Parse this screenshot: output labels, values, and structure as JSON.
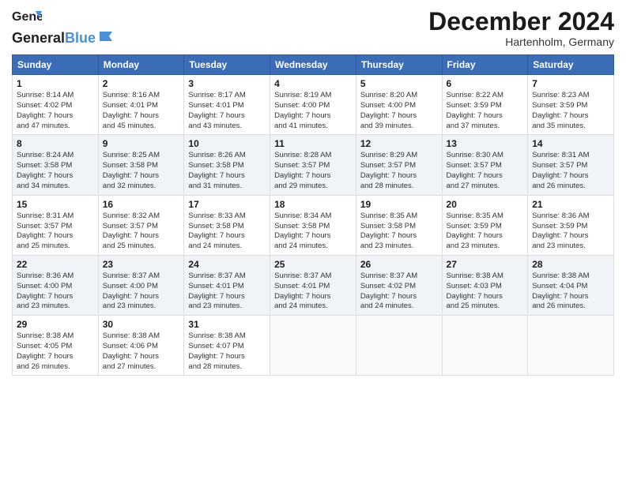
{
  "header": {
    "logo_general": "General",
    "logo_blue": "Blue",
    "month_title": "December 2024",
    "location": "Hartenholm, Germany"
  },
  "days_of_week": [
    "Sunday",
    "Monday",
    "Tuesday",
    "Wednesday",
    "Thursday",
    "Friday",
    "Saturday"
  ],
  "weeks": [
    [
      {
        "day": 1,
        "sunrise": "8:14 AM",
        "sunset": "4:02 PM",
        "daylight": "7 hours and 47 minutes."
      },
      {
        "day": 2,
        "sunrise": "8:16 AM",
        "sunset": "4:01 PM",
        "daylight": "7 hours and 45 minutes."
      },
      {
        "day": 3,
        "sunrise": "8:17 AM",
        "sunset": "4:01 PM",
        "daylight": "7 hours and 43 minutes."
      },
      {
        "day": 4,
        "sunrise": "8:19 AM",
        "sunset": "4:00 PM",
        "daylight": "7 hours and 41 minutes."
      },
      {
        "day": 5,
        "sunrise": "8:20 AM",
        "sunset": "4:00 PM",
        "daylight": "7 hours and 39 minutes."
      },
      {
        "day": 6,
        "sunrise": "8:22 AM",
        "sunset": "3:59 PM",
        "daylight": "7 hours and 37 minutes."
      },
      {
        "day": 7,
        "sunrise": "8:23 AM",
        "sunset": "3:59 PM",
        "daylight": "7 hours and 35 minutes."
      }
    ],
    [
      {
        "day": 8,
        "sunrise": "8:24 AM",
        "sunset": "3:58 PM",
        "daylight": "7 hours and 34 minutes."
      },
      {
        "day": 9,
        "sunrise": "8:25 AM",
        "sunset": "3:58 PM",
        "daylight": "7 hours and 32 minutes."
      },
      {
        "day": 10,
        "sunrise": "8:26 AM",
        "sunset": "3:58 PM",
        "daylight": "7 hours and 31 minutes."
      },
      {
        "day": 11,
        "sunrise": "8:28 AM",
        "sunset": "3:57 PM",
        "daylight": "7 hours and 29 minutes."
      },
      {
        "day": 12,
        "sunrise": "8:29 AM",
        "sunset": "3:57 PM",
        "daylight": "7 hours and 28 minutes."
      },
      {
        "day": 13,
        "sunrise": "8:30 AM",
        "sunset": "3:57 PM",
        "daylight": "7 hours and 27 minutes."
      },
      {
        "day": 14,
        "sunrise": "8:31 AM",
        "sunset": "3:57 PM",
        "daylight": "7 hours and 26 minutes."
      }
    ],
    [
      {
        "day": 15,
        "sunrise": "8:31 AM",
        "sunset": "3:57 PM",
        "daylight": "7 hours and 25 minutes."
      },
      {
        "day": 16,
        "sunrise": "8:32 AM",
        "sunset": "3:57 PM",
        "daylight": "7 hours and 25 minutes."
      },
      {
        "day": 17,
        "sunrise": "8:33 AM",
        "sunset": "3:58 PM",
        "daylight": "7 hours and 24 minutes."
      },
      {
        "day": 18,
        "sunrise": "8:34 AM",
        "sunset": "3:58 PM",
        "daylight": "7 hours and 24 minutes."
      },
      {
        "day": 19,
        "sunrise": "8:35 AM",
        "sunset": "3:58 PM",
        "daylight": "7 hours and 23 minutes."
      },
      {
        "day": 20,
        "sunrise": "8:35 AM",
        "sunset": "3:59 PM",
        "daylight": "7 hours and 23 minutes."
      },
      {
        "day": 21,
        "sunrise": "8:36 AM",
        "sunset": "3:59 PM",
        "daylight": "7 hours and 23 minutes."
      }
    ],
    [
      {
        "day": 22,
        "sunrise": "8:36 AM",
        "sunset": "4:00 PM",
        "daylight": "7 hours and 23 minutes."
      },
      {
        "day": 23,
        "sunrise": "8:37 AM",
        "sunset": "4:00 PM",
        "daylight": "7 hours and 23 minutes."
      },
      {
        "day": 24,
        "sunrise": "8:37 AM",
        "sunset": "4:01 PM",
        "daylight": "7 hours and 23 minutes."
      },
      {
        "day": 25,
        "sunrise": "8:37 AM",
        "sunset": "4:01 PM",
        "daylight": "7 hours and 24 minutes."
      },
      {
        "day": 26,
        "sunrise": "8:37 AM",
        "sunset": "4:02 PM",
        "daylight": "7 hours and 24 minutes."
      },
      {
        "day": 27,
        "sunrise": "8:38 AM",
        "sunset": "4:03 PM",
        "daylight": "7 hours and 25 minutes."
      },
      {
        "day": 28,
        "sunrise": "8:38 AM",
        "sunset": "4:04 PM",
        "daylight": "7 hours and 26 minutes."
      }
    ],
    [
      {
        "day": 29,
        "sunrise": "8:38 AM",
        "sunset": "4:05 PM",
        "daylight": "7 hours and 26 minutes."
      },
      {
        "day": 30,
        "sunrise": "8:38 AM",
        "sunset": "4:06 PM",
        "daylight": "7 hours and 27 minutes."
      },
      {
        "day": 31,
        "sunrise": "8:38 AM",
        "sunset": "4:07 PM",
        "daylight": "7 hours and 28 minutes."
      },
      null,
      null,
      null,
      null
    ]
  ],
  "labels": {
    "sunrise": "Sunrise:",
    "sunset": "Sunset:",
    "daylight": "Daylight:"
  }
}
